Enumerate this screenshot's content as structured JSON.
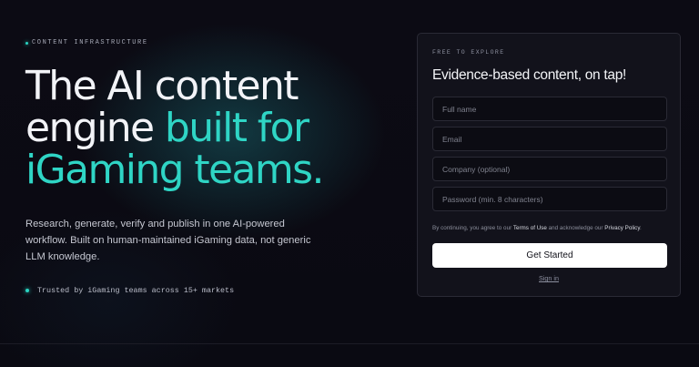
{
  "hero": {
    "eyebrow": "CONTENT INFRASTRUCTURE",
    "headline": {
      "line1": "The AI content",
      "line2_plain": "engine ",
      "line2_accent": "built for",
      "line3_accent": "iGaming teams."
    },
    "subtext": "Research, generate, verify and publish in one AI-powered workflow. Built on human-maintained iGaming data, not generic LLM knowledge.",
    "trust": "Trusted by iGaming teams across 15+ markets"
  },
  "signup": {
    "eyebrow": "FREE TO EXPLORE",
    "title": "Evidence-based content, on tap!",
    "fields": {
      "full_name": {
        "placeholder": "Full name",
        "value": ""
      },
      "email": {
        "placeholder": "Email",
        "value": ""
      },
      "company": {
        "placeholder": "Company (optional)",
        "value": ""
      },
      "password": {
        "placeholder": "Password (min. 8 characters)",
        "value": ""
      }
    },
    "consent": {
      "prefix": "By continuing, you agree to our ",
      "terms": "Terms of Use",
      "middle": " and acknowledge our ",
      "privacy": "Privacy Policy",
      "suffix": "."
    },
    "submit_label": "Get Started",
    "signin_label": "Sign in"
  },
  "colors": {
    "background": "#0a0a12",
    "accent": "#2fd5c5",
    "card": "#12121b",
    "button": "#ffffff"
  }
}
